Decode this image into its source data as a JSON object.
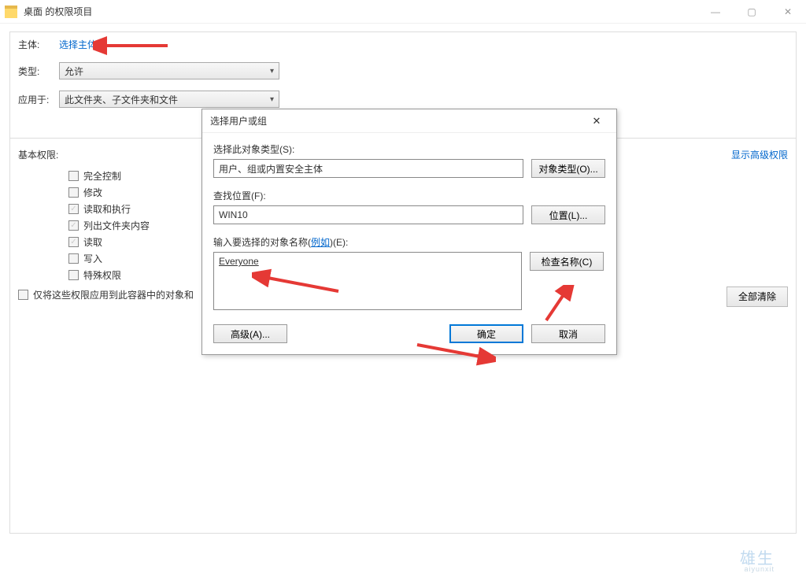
{
  "titlebar": {
    "title": "桌面 的权限项目"
  },
  "fields": {
    "principal_label": "主体:",
    "principal_link": "选择主体",
    "type_label": "类型:",
    "type_value": "允许",
    "applies_label": "应用于:",
    "applies_value": "此文件夹、子文件夹和文件"
  },
  "permissions": {
    "section": "基本权限:",
    "advanced_link": "显示高级权限",
    "items": [
      {
        "label": "完全控制",
        "checked": false
      },
      {
        "label": "修改",
        "checked": false
      },
      {
        "label": "读取和执行",
        "checked": true
      },
      {
        "label": "列出文件夹内容",
        "checked": true
      },
      {
        "label": "读取",
        "checked": true
      },
      {
        "label": "写入",
        "checked": false
      },
      {
        "label": "特殊权限",
        "checked": false
      }
    ],
    "only_apply": "仅将这些权限应用到此容器中的对象和",
    "clear_all": "全部清除"
  },
  "modal": {
    "title": "选择用户或组",
    "object_type_label": "选择此对象类型(S):",
    "object_type_value": "用户、组或内置安全主体",
    "object_type_btn": "对象类型(O)...",
    "location_label": "查找位置(F):",
    "location_value": "WIN10",
    "location_btn": "位置(L)...",
    "name_label_pre": "输入要选择的对象名称(",
    "name_label_link": "例如",
    "name_label_post": ")(E):",
    "name_value": "Everyone",
    "check_btn": "检查名称(C)",
    "advanced_btn": "高级(A)...",
    "ok_btn": "确定",
    "cancel_btn": "取消"
  },
  "watermark": {
    "main": "雄生",
    "sub": "aiyunxit"
  }
}
